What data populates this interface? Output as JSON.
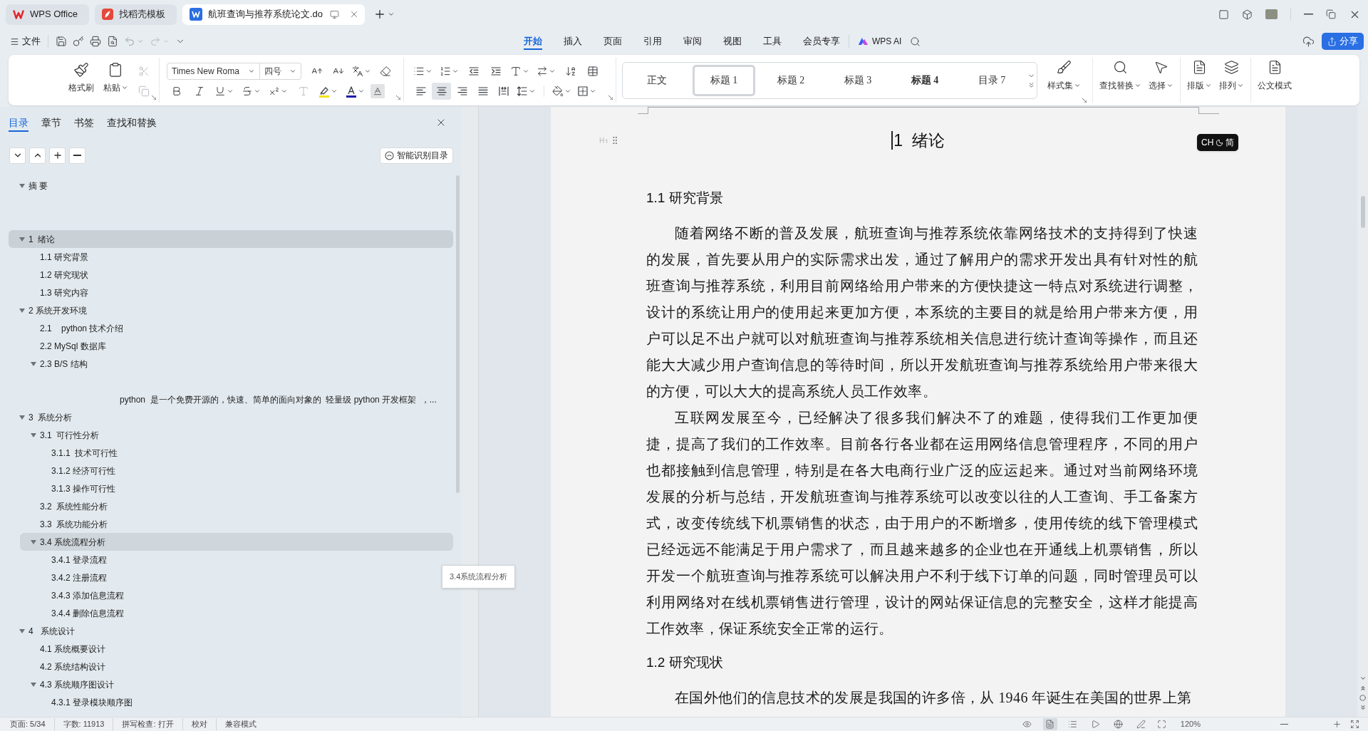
{
  "tabs": [
    {
      "kind": "home",
      "label": "WPS Office",
      "selected": false
    },
    {
      "kind": "template",
      "label": "找稻壳模板",
      "selected": false
    },
    {
      "kind": "document",
      "label": "航班查询与推荐系统论文.do",
      "selected": true
    }
  ],
  "menu": {
    "file": "文件",
    "tabs": [
      {
        "label": "开始",
        "selected": true
      },
      {
        "label": "插入",
        "selected": false
      },
      {
        "label": "页面",
        "selected": false
      },
      {
        "label": "引用",
        "selected": false
      },
      {
        "label": "审阅",
        "selected": false
      },
      {
        "label": "视图",
        "selected": false
      },
      {
        "label": "工具",
        "selected": false
      },
      {
        "label": "会员专享",
        "selected": false
      }
    ],
    "ai": "WPS AI",
    "share": "分享"
  },
  "ribbon": {
    "format_painter": "格式刷",
    "paste": "粘贴",
    "font_family": "Times New Roma",
    "font_size": "四号",
    "align_buttons": [
      {
        "kind": "left",
        "selected": false
      },
      {
        "kind": "center",
        "selected": true
      },
      {
        "kind": "right",
        "selected": false
      },
      {
        "kind": "justify",
        "selected": false
      },
      {
        "kind": "distributed",
        "selected": false
      }
    ],
    "styles": [
      {
        "label": "正文",
        "kind": "plain",
        "selected": false
      },
      {
        "label": "标题 1",
        "kind": "plain",
        "selected": true
      },
      {
        "label": "标题 2",
        "kind": "plain",
        "selected": false
      },
      {
        "label": "标题 3",
        "kind": "plain",
        "selected": false
      },
      {
        "label": "标题 4",
        "kind": "bold",
        "selected": false
      },
      {
        "label": "目录 7",
        "kind": "plain",
        "selected": false
      }
    ],
    "tools": [
      {
        "kind": "style-set",
        "label": "样式集"
      },
      {
        "kind": "find",
        "label": "查找替换"
      },
      {
        "kind": "select",
        "label": "选择"
      },
      {
        "kind": "layout",
        "label": "排版"
      },
      {
        "kind": "arrange",
        "label": "排列"
      },
      {
        "kind": "official",
        "label": "公文模式"
      }
    ]
  },
  "nav": {
    "tabs": [
      {
        "label": "目录",
        "selected": true
      },
      {
        "label": "章节",
        "selected": false
      },
      {
        "label": "书签",
        "selected": false
      },
      {
        "label": "查找和替换",
        "selected": false
      }
    ],
    "smart_button": "智能识别目录",
    "tooltip": "3.4系统流程分析",
    "tree": [
      {
        "kind": "heading",
        "text": "摘 要",
        "selected": false,
        "hovered": false,
        "expanded": true,
        "children": [
          {
            "kind": "blank"
          },
          {
            "kind": "blank"
          }
        ]
      },
      {
        "kind": "heading",
        "text": "1  绪论",
        "selected": true,
        "hovered": false,
        "expanded": true,
        "children": [
          {
            "kind": "heading",
            "text": "1.1 研究背景",
            "selected": false,
            "hovered": false
          },
          {
            "kind": "heading",
            "text": "1.2 研究现状",
            "selected": false,
            "hovered": false
          },
          {
            "kind": "heading",
            "text": "1.3 研究内容",
            "selected": false,
            "hovered": false
          }
        ]
      },
      {
        "kind": "heading",
        "text": "2 系统开发环境",
        "selected": false,
        "hovered": false,
        "expanded": true,
        "children": [
          {
            "kind": "heading",
            "text": "2.1    python 技术介绍",
            "selected": false,
            "hovered": false
          },
          {
            "kind": "heading",
            "text": "2.2 MySql 数据库",
            "selected": false,
            "hovered": false
          },
          {
            "kind": "heading",
            "text": "2.3 B/S 结构",
            "selected": false,
            "hovered": false,
            "expanded": true,
            "children": [
              {
                "kind": "blank"
              },
              {
                "kind": "body",
                "text": "python  是一个免费开源的，快速、简单的面向对象的  轻量级 python 开发框架  ，...",
                "selected": false,
                "hovered": false
              }
            ]
          }
        ]
      },
      {
        "kind": "heading",
        "text": "3  系统分析",
        "selected": false,
        "hovered": false,
        "expanded": true,
        "children": [
          {
            "kind": "heading",
            "text": "3.1  可行性分析",
            "selected": false,
            "hovered": false,
            "expanded": true,
            "children": [
              {
                "kind": "heading",
                "text": "3.1.1  技术可行性",
                "selected": false,
                "hovered": false
              },
              {
                "kind": "heading",
                "text": "3.1.2 经济可行性",
                "selected": false,
                "hovered": false
              },
              {
                "kind": "heading",
                "text": "3.1.3 操作可行性",
                "selected": false,
                "hovered": false
              }
            ]
          },
          {
            "kind": "heading",
            "text": "3.2  系统性能分析",
            "selected": false,
            "hovered": false
          },
          {
            "kind": "heading",
            "text": "3.3  系统功能分析",
            "selected": false,
            "hovered": false
          },
          {
            "kind": "heading",
            "text": "3.4 系统流程分析",
            "selected": false,
            "hovered": true,
            "expanded": true,
            "children": [
              {
                "kind": "heading",
                "text": "3.4.1 登录流程",
                "selected": false,
                "hovered": false
              },
              {
                "kind": "heading",
                "text": "3.4.2 注册流程",
                "selected": false,
                "hovered": false
              },
              {
                "kind": "heading",
                "text": "3.4.3 添加信息流程",
                "selected": false,
                "hovered": false
              },
              {
                "kind": "heading",
                "text": "3.4.4 删除信息流程",
                "selected": false,
                "hovered": false
              }
            ]
          }
        ]
      },
      {
        "kind": "heading",
        "text": "4   系统设计",
        "selected": false,
        "hovered": false,
        "expanded": true,
        "children": [
          {
            "kind": "heading",
            "text": "4.1 系统概要设计",
            "selected": false,
            "hovered": false
          },
          {
            "kind": "heading",
            "text": "4.2 系统结构设计",
            "selected": false,
            "hovered": false
          },
          {
            "kind": "heading",
            "text": "4.3 系统顺序图设计",
            "selected": false,
            "hovered": false,
            "expanded": true,
            "children": [
              {
                "kind": "heading",
                "text": "4.3.1 登录模块顺序图",
                "selected": false,
                "hovered": false
              }
            ]
          }
        ]
      }
    ]
  },
  "document": {
    "title": "1  绪论",
    "ime": {
      "mode": "CH",
      "script": "简"
    },
    "blocks": [
      {
        "kind": "heading",
        "text": "1.1 研究背景"
      },
      {
        "kind": "paragraph",
        "text": "随着网络不断的普及发展，航班查询与推荐系统依靠网络技术的支持得到了快速的发展，首先要从用户的实际需求出发，通过了解用户的需求开发出具有针对性的航班查询与推荐系统，利用目前网络给用户带来的方便快捷这一特点对系统进行调整，设计的系统让用户的使用起来更加方便，本系统的主要目的就是给用户带来方便，用户可以足不出户就可以对航班查询与推荐系统相关信息进行统计查询等操作，而且还能大大减少用户查询信息的等待时间，所以开发航班查询与推荐系统给用户带来很大的方便，可以大大的提高系统人员工作效率。"
      },
      {
        "kind": "paragraph",
        "text": "互联网发展至今，已经解决了很多我们解决不了的难题，使得我们工作更加便捷，提高了我们的工作效率。目前各行各业都在运用网络信息管理程序，不同的用户也都接触到信息管理，特别是在各大电商行业广泛的应运起来。通过对当前网络环境发展的分析与总结，开发航班查询与推荐系统可以改变以往的人工查询、手工备案方式，改变传统线下机票销售的状态，由于用户的不断增多，使用传统的线下管理模式已经远远不能满足于用户需求了，而且越来越多的企业也在开通线上机票销售，所以开发一个航班查询与推荐系统可以解决用户不利于线下订单的问题，同时管理员可以利用网络对在线机票销售进行管理，设计的网站保证信息的完整安全，这样才能提高工作效率，保证系统安全正常的运行。"
      },
      {
        "kind": "heading",
        "text": "1.2 研究现状"
      },
      {
        "kind": "paragraph",
        "text": "在国外他们的信息技术的发展是我国的许多倍，从 1946 年诞生在美国的世界上第"
      }
    ]
  },
  "status_bar": {
    "page": "页面: 5/34",
    "words": "字数: 11913",
    "spell": "拼写检查: 打开",
    "proofread": "校对",
    "compat": "兼容模式",
    "zoom": "120%",
    "view_modes": [
      {
        "kind": "eye",
        "selected": false
      },
      {
        "kind": "page",
        "selected": true
      },
      {
        "kind": "outline",
        "selected": false
      },
      {
        "kind": "play",
        "selected": false
      },
      {
        "kind": "web",
        "selected": false
      },
      {
        "kind": "write",
        "selected": false
      }
    ]
  }
}
